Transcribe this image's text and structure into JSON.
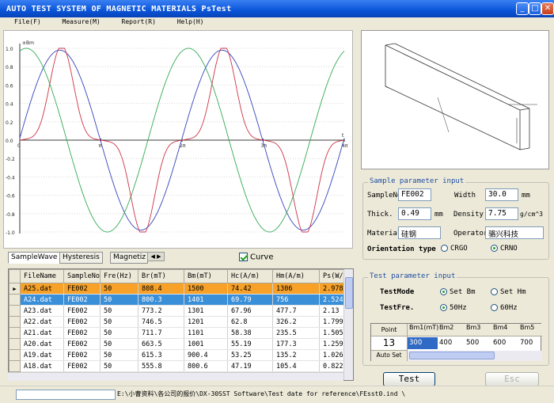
{
  "window": {
    "title": "AUTO TEST SYSTEM OF MAGNETIC MATERIALS   PsTest"
  },
  "menu": [
    "File(F)",
    "Measure(M)",
    "Report(R)",
    "Help(H)"
  ],
  "chart_data": {
    "type": "line",
    "ylabel": "±Bm",
    "xlabel": "t",
    "ylim": [
      -1.0,
      1.0
    ],
    "xlim_label": "4π",
    "y_ticks": [
      "1.0",
      "0.8",
      "0.6",
      "0.4",
      "0.2",
      "0.0",
      "-0.2",
      "-0.4",
      "-0.6",
      "-0.8",
      "-1.0"
    ],
    "x_ticks": [
      "0",
      "π",
      "2π",
      "3π",
      "4π"
    ],
    "series": [
      {
        "color": "#3344bb",
        "shape": "sine-lagged"
      },
      {
        "color": "#33aa55",
        "shape": "cosine"
      },
      {
        "color": "#cc3344",
        "shape": "peaked"
      }
    ],
    "grid": true
  },
  "tabs": {
    "tab1": "SampleWave",
    "tab2": "Hysteresis",
    "tab3": "Magnetiz"
  },
  "curve_label": "Curve",
  "table": {
    "columns": [
      "FileName",
      "SampleNo",
      "Fre(Hz)",
      "Br(mT)",
      "Bm(mT)",
      "Hc(A/m)",
      "Hm(A/m)",
      "Ps(W/"
    ],
    "rows": [
      [
        "A25.dat",
        "FE002",
        "50",
        "808.4",
        "1500",
        "74.42",
        "1306",
        "2.978"
      ],
      [
        "A24.dat",
        "FE002",
        "50",
        "800.3",
        "1401",
        "69.79",
        "756",
        "2.524"
      ],
      [
        "A23.dat",
        "FE002",
        "50",
        "773.2",
        "1301",
        "67.96",
        "477.7",
        "2.13"
      ],
      [
        "A22.dat",
        "FE002",
        "50",
        "746.5",
        "1201",
        "62.8",
        "326.2",
        "1.799"
      ],
      [
        "A21.dat",
        "FE002",
        "50",
        "711.7",
        "1101",
        "58.38",
        "235.5",
        "1.505"
      ],
      [
        "A20.dat",
        "FE002",
        "50",
        "663.5",
        "1001",
        "55.19",
        "177.3",
        "1.259"
      ],
      [
        "A19.dat",
        "FE002",
        "50",
        "615.3",
        "900.4",
        "53.25",
        "135.2",
        "1.026"
      ],
      [
        "A18.dat",
        "FE002",
        "50",
        "555.8",
        "800.6",
        "47.19",
        "105.4",
        "0.822"
      ]
    ],
    "row_colors": [
      "#f7a128",
      "#3a8fd9"
    ]
  },
  "sample": {
    "legend": "Sample parameter input",
    "sampleno_label": "SampleNo",
    "sampleno": "FE002",
    "width_label": "Width",
    "width": "30.0",
    "width_unit": "mm",
    "thick_label": "Thick.",
    "thick": "0.49",
    "thick_unit": "mm",
    "density_label": "Density",
    "density": "7.75",
    "density_unit": "g/cm^3",
    "material_label": "Material",
    "material": "硅钢",
    "operator_label": "Operator",
    "operator": "骆兴科技",
    "orient_label": "Orientation type",
    "orient_opt1": "CRGO",
    "orient_opt2": "CRNO"
  },
  "test": {
    "legend": "Test parameter input",
    "mode_label": "TestMode",
    "mode_opt1": "Set Bm",
    "mode_opt2": "Set Hm",
    "fre_label": "TestFre.",
    "fre_opt1": "50Hz",
    "fre_opt2": "60Hz",
    "grid_headers": [
      "Point",
      "Bm1(mT)",
      "Bm2",
      "Bm3",
      "Bm4",
      "Bm5"
    ],
    "point": "13",
    "bm_values": [
      "300",
      "400",
      "500",
      "600",
      "700"
    ],
    "autoset_label": "Auto Set"
  },
  "buttons": {
    "test": "Test",
    "esc": "Esc"
  },
  "status": {
    "path": "E:\\小曹资料\\各公司的报价\\DX-30SST Software\\Test date for reference\\FEsst0.ind \\"
  }
}
